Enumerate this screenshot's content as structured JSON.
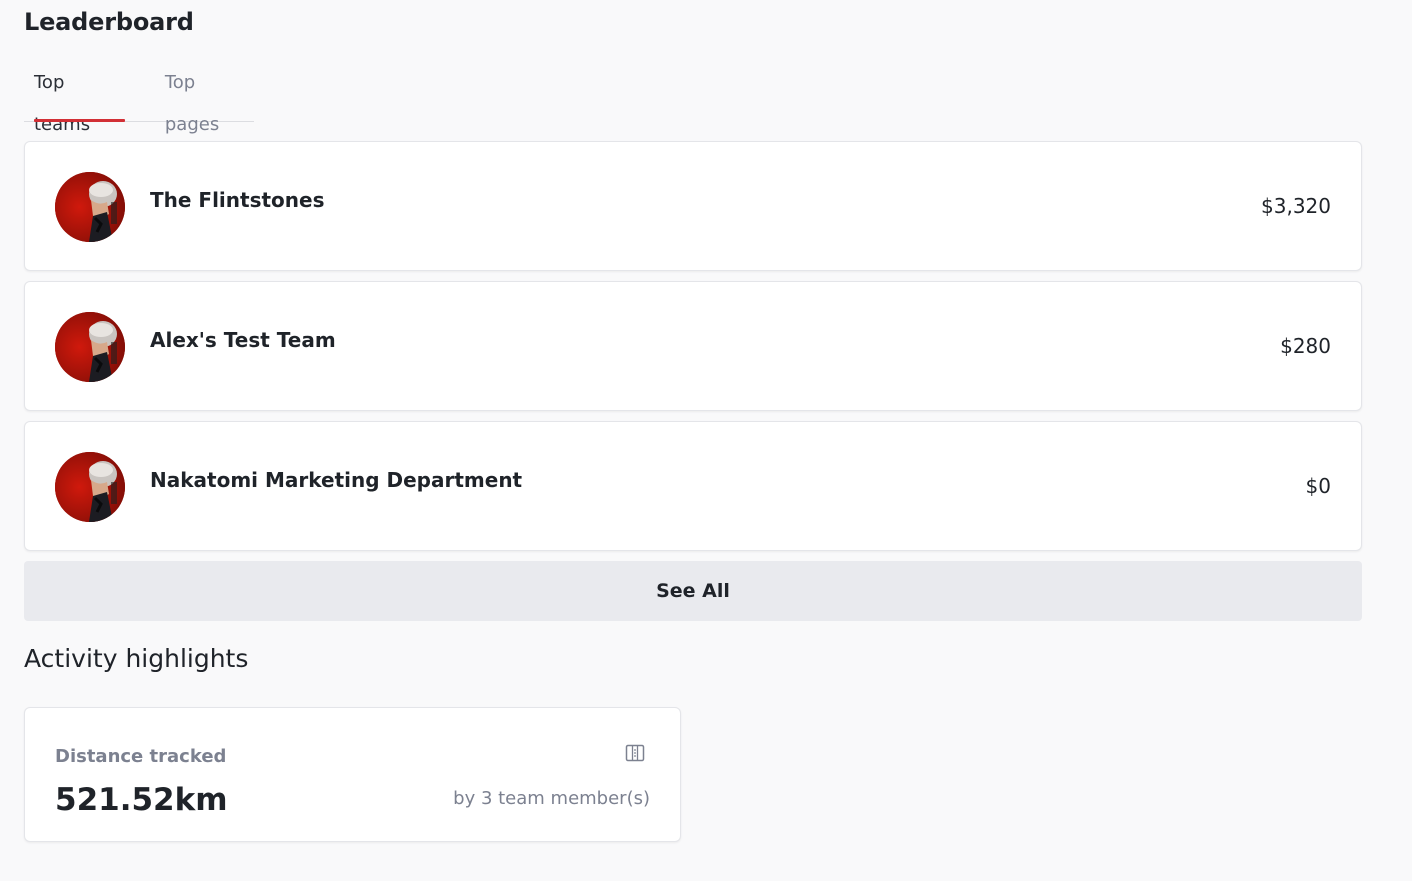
{
  "leaderboard": {
    "title": "Leaderboard",
    "tabs": [
      {
        "label": "Top teams",
        "active": true
      },
      {
        "label": "Top pages",
        "active": false
      }
    ],
    "teams": [
      {
        "name": "The Flintstones",
        "amount": "$3,320"
      },
      {
        "name": "Alex's Test Team",
        "amount": "$280"
      },
      {
        "name": "Nakatomi Marketing Department",
        "amount": "$0"
      }
    ],
    "see_all_label": "See All"
  },
  "activity": {
    "title": "Activity highlights",
    "card": {
      "label": "Distance tracked",
      "value": "521.52km",
      "sub": "by 3 team member(s)",
      "icon": "map-icon"
    }
  },
  "colors": {
    "accent": "#d22f35",
    "background": "#f9f9fa",
    "card": "#ffffff",
    "muted_text": "#7c8190",
    "button_bg": "#e9eaee"
  }
}
